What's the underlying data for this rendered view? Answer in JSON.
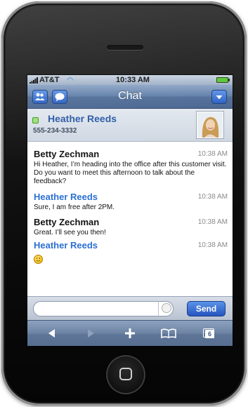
{
  "status_bar": {
    "carrier": "AT&T",
    "time": "10:33 AM"
  },
  "nav": {
    "title": "Chat",
    "left_icons": [
      "contacts-icon",
      "chat-bubble-icon"
    ],
    "right_icon": "chevron-down-icon"
  },
  "contact": {
    "name": "Heather Reeds",
    "phone": "555-234-3332",
    "presence": "online",
    "presence_color": "#58c832"
  },
  "messages": [
    {
      "sender": "Betty Zechman",
      "time": "10:38 AM",
      "text": "Hi Heather, I’m heading into the office after this customer visit. Do you want to meet this afternoon to talk about the feedback?"
    },
    {
      "sender": "Heather Reeds",
      "time": "10:38 AM",
      "text": "Sure, I am free after 2PM."
    },
    {
      "sender": "Betty Zechman",
      "time": "10:38 AM",
      "text": "Great. I’ll see you then!"
    },
    {
      "sender": "Heather Reeds",
      "time": "10:38 AM",
      "text": "",
      "emoji": "smiley-icon"
    }
  ],
  "composer": {
    "input_value": "",
    "send_label": "Send",
    "emoji_icon": "smiley-icon"
  },
  "toolbar": {
    "buttons": [
      "back-icon",
      "forward-icon",
      "add-icon",
      "bookmarks-icon",
      "pages-icon"
    ],
    "pages_count": "6"
  },
  "colors": {
    "accent": "#2a6fd2",
    "nav": "#5f7ea8",
    "send": "#2455c0"
  }
}
